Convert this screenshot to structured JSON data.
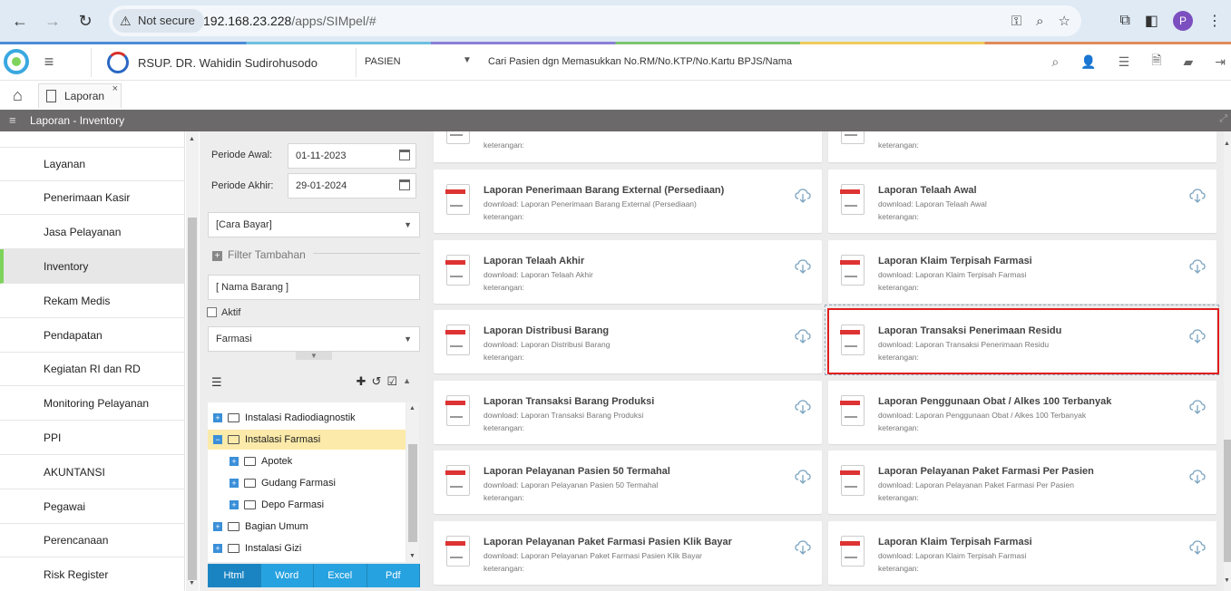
{
  "browser": {
    "security_label": "Not secure",
    "url_host": "192.168.23.228",
    "url_path": "/apps/SIMpel/#",
    "profile_initial": "P"
  },
  "header": {
    "hospital_name": "RSUP. DR. Wahidin Sudirohusodo",
    "patient_scope": "PASIEN",
    "search_placeholder": "Cari Pasien dgn Memasukkan No.RM/No.KTP/No.Kartu BPJS/Nama"
  },
  "tabs": [
    {
      "label": "Laporan",
      "close": "×"
    }
  ],
  "titlebar": {
    "title": "Laporan - Inventory"
  },
  "menu": {
    "items": [
      {
        "label": "Layanan"
      },
      {
        "label": "Penerimaan Kasir"
      },
      {
        "label": "Jasa Pelayanan"
      },
      {
        "label": "Inventory"
      },
      {
        "label": "Rekam Medis"
      },
      {
        "label": "Pendapatan"
      },
      {
        "label": "Kegiatan RI dan RD"
      },
      {
        "label": "Monitoring Pelayanan"
      },
      {
        "label": "PPI"
      },
      {
        "label": "AKUNTANSI"
      },
      {
        "label": "Pegawai"
      },
      {
        "label": "Perencanaan"
      },
      {
        "label": "Risk Register"
      }
    ],
    "active": "Inventory"
  },
  "filter": {
    "periode_awal_label": "Periode Awal:",
    "periode_awal": "01-11-2023",
    "periode_akhir_label": "Periode Akhir:",
    "periode_akhir": "29-01-2024",
    "cara_bayar": "[Cara Bayar]",
    "filter_tambahan": "Filter Tambahan",
    "nama_barang": "[ Nama Barang ]",
    "aktif_label": "Aktif",
    "aktif_checked": false,
    "farmasi": "Farmasi"
  },
  "tree": {
    "nodes": [
      {
        "label": "Instalasi Radiodiagnostik",
        "toggle": "+"
      },
      {
        "label": "Instalasi Farmasi",
        "toggle": "−"
      },
      {
        "label": "Apotek",
        "toggle": "+"
      },
      {
        "label": "Gudang Farmasi",
        "toggle": "+"
      },
      {
        "label": "Depo Farmasi",
        "toggle": "+"
      },
      {
        "label": "Bagian Umum",
        "toggle": "+"
      },
      {
        "label": "Instalasi Gizi",
        "toggle": "+"
      }
    ],
    "selected": "Instalasi Farmasi"
  },
  "exports": [
    "Html",
    "Word",
    "Excel",
    "Pdf"
  ],
  "exports_active": "Html",
  "reports": {
    "keterangan_label": "keterangan:",
    "download_prefix": "download:",
    "left": [
      {
        "title": "Laporan Penerimaan Barang External (Persediaan)",
        "download": "Laporan Penerimaan Barang External (Persediaan)"
      },
      {
        "title": "Laporan Telaah Akhir",
        "download": "Laporan Telaah Akhir"
      },
      {
        "title": "Laporan Distribusi Barang",
        "download": "Laporan Distribusi Barang"
      },
      {
        "title": "Laporan Transaksi Barang Produksi",
        "download": "Laporan Transaksi Barang Produksi"
      },
      {
        "title": "Laporan Pelayanan Pasien 50 Termahal",
        "download": "Laporan Pelayanan Pasien 50 Termahal"
      },
      {
        "title": "Laporan Pelayanan Paket Farmasi Pasien Klik Bayar",
        "download": "Laporan Pelayanan Paket Farmasi Pasien Klik Bayar"
      }
    ],
    "right": [
      {
        "title": "Laporan Telaah Awal",
        "download": "Laporan Telaah Awal"
      },
      {
        "title": "Laporan Klaim Terpisah Farmasi",
        "download": "Laporan Klaim Terpisah Farmasi"
      },
      {
        "title": "Laporan Transaksi Penerimaan Residu",
        "download": "Laporan Transaksi Penerimaan Residu"
      },
      {
        "title": "Laporan Penggunaan Obat / Alkes 100 Terbanyak",
        "download": "Laporan Penggunaan Obat / Alkes 100 Terbanyak"
      },
      {
        "title": "Laporan Pelayanan Paket Farmasi Per Pasien",
        "download": "Laporan Pelayanan Paket Farmasi Per Pasien"
      },
      {
        "title": "Laporan Klaim Terpisah Farmasi",
        "download": "Laporan Klaim Terpisah Farmasi"
      }
    ],
    "highlighted": "Laporan Transaksi Penerimaan Residu"
  },
  "colors": {
    "accent": "#27a2e0",
    "active_menu_border": "#7ed35c",
    "highlight_border": "#e01e1e",
    "titlebar": "#6b6969"
  }
}
